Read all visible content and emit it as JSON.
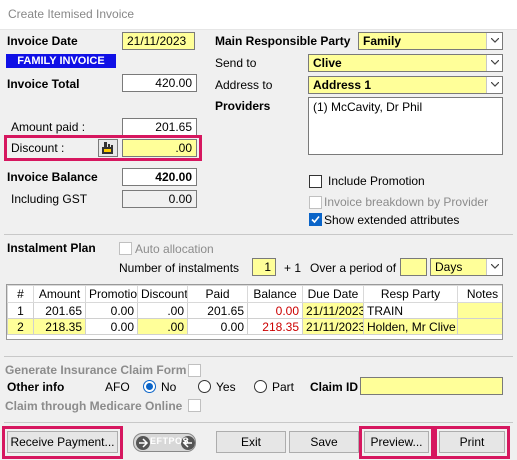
{
  "window": {
    "title": "Create Itemised Invoice"
  },
  "invoice": {
    "date_label": "Invoice Date",
    "date_value": "21/11/2023",
    "badge": "FAMILY INVOICE",
    "total_label": "Invoice Total",
    "total_value": "420.00",
    "amount_paid_label": "Amount paid :",
    "amount_paid_value": "201.65",
    "discount_label": "Discount :",
    "discount_value": ".00",
    "balance_label": "Invoice Balance",
    "balance_value": "420.00",
    "gst_label": "Including GST",
    "gst_value": "0.00"
  },
  "party": {
    "main_label": "Main Responsible Party",
    "main_value": "Family",
    "send_to_label": "Send to",
    "send_to_value": "Clive",
    "address_label": "Address to",
    "address_value": "Address 1",
    "providers_label": "Providers",
    "providers_value": "(1) McCavity, Dr Phil"
  },
  "options": {
    "include_promotion": "Include Promotion",
    "invoice_breakdown": "Invoice breakdown by Provider",
    "show_extended": "Show extended attributes"
  },
  "instalment": {
    "title": "Instalment Plan",
    "auto_allocation": "Auto allocation",
    "number_label": "Number of instalments",
    "number_value": "1",
    "plus_one": "+ 1",
    "period_label": "Over a period of",
    "period_value": "",
    "period_unit": "Days"
  },
  "table": {
    "headers": [
      "#",
      "Amount",
      "Promotion",
      "Discount",
      "Paid",
      "Balance",
      "Due Date",
      "Resp Party",
      "Notes"
    ],
    "rows": [
      {
        "num": "1",
        "amount": "201.65",
        "promotion": "0.00",
        "discount": ".00",
        "paid": "201.65",
        "balance": "0.00",
        "due": "21/11/2023",
        "party": "TRAIN",
        "notes": ""
      },
      {
        "num": "2",
        "amount": "218.35",
        "promotion": "0.00",
        "discount": ".00",
        "paid": "0.00",
        "balance": "218.35",
        "due": "21/11/2023",
        "party": "Holden, Mr Clive",
        "notes": ""
      }
    ]
  },
  "claims": {
    "generate_label": "Generate Insurance Claim Form",
    "other_info_label": "Other info",
    "afo_label": "AFO",
    "no_label": "No",
    "yes_label": "Yes",
    "part_label": "Part",
    "claim_id_label": "Claim ID",
    "claim_id_value": "",
    "medicare_label": "Claim through Medicare Online"
  },
  "buttons": {
    "receive_payment": "Receive  Payment...",
    "eftpos": "EFTPOS",
    "exit": "Exit",
    "save": "Save",
    "preview": "Preview...",
    "print": "Print"
  }
}
